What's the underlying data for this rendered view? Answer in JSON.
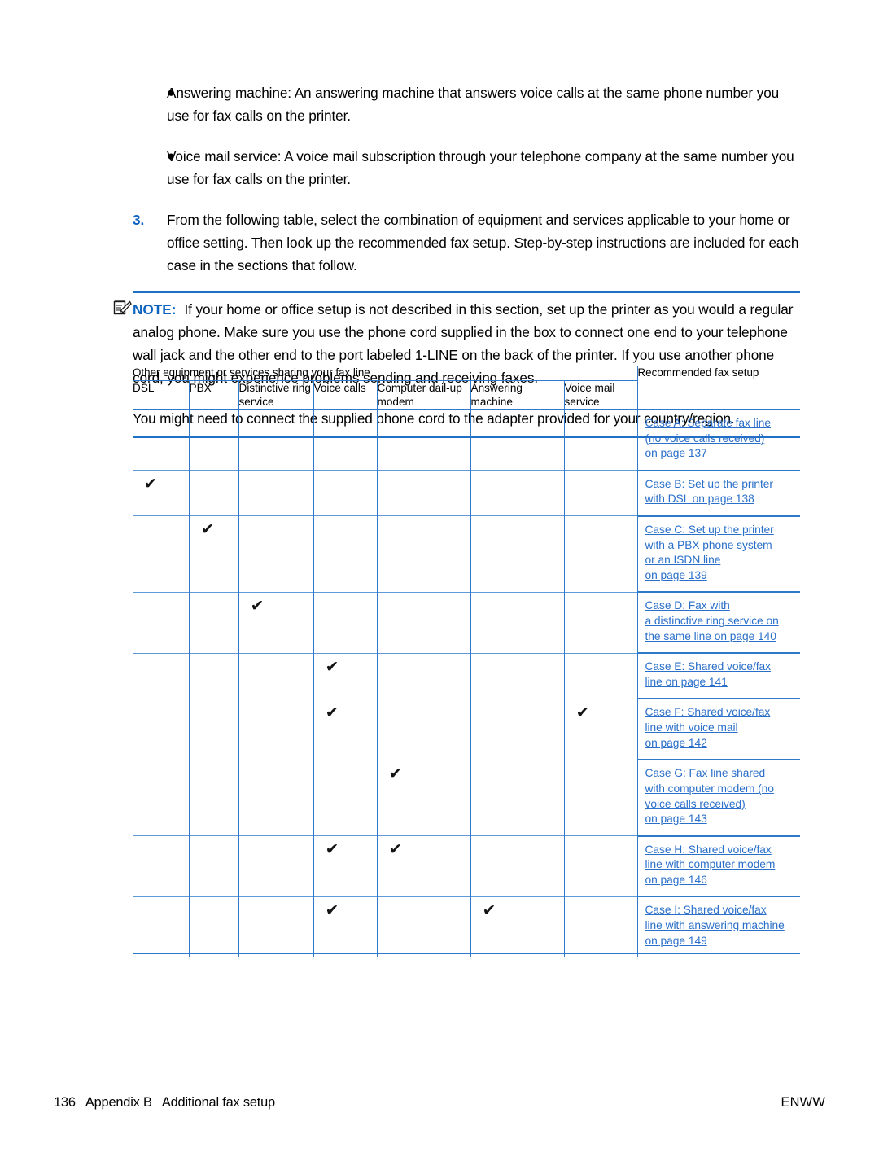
{
  "bullets": [
    {
      "marker": "●",
      "text": "Answering machine: An answering machine that answers voice calls at the same phone number you use for fax calls on the printer."
    },
    {
      "marker": "●",
      "text": "Voice mail service: A voice mail subscription through your telephone company at the same number you use for fax calls on the printer."
    }
  ],
  "step": {
    "number": "3.",
    "text": "From the following table, select the combination of equipment and services applicable to your home or office setting. Then look up the recommended fax setup. Step-by-step instructions are included for each case in the sections that follow."
  },
  "note": {
    "icon": "note-pencil-icon",
    "label": "NOTE:",
    "body": "If your home or office setup is not described in this section, set up the printer as you would a regular analog phone. Make sure you use the phone cord supplied in the box to connect one end to your telephone wall jack and the other end to the port labeled 1-LINE on the back of the printer. If you use another phone cord, you might experience problems sending and receiving faxes.",
    "paragraph2": "You might need to connect the supplied phone cord to the adapter provided for your country/region."
  },
  "table": {
    "group_headers": {
      "left": "Other equipment or services sharing your fax line",
      "right": "Recommended fax setup"
    },
    "columns": [
      "DSL",
      "PBX",
      "Distinctive ring service",
      "Voice calls",
      "Computer dail-up modem",
      "Answering machine",
      "Voice mail service"
    ],
    "check_glyph": "✔",
    "rows": [
      {
        "checks": [
          false,
          false,
          false,
          false,
          false,
          false,
          false
        ],
        "link_lines": [
          "Case A: Separate fax line",
          "(no voice calls received)",
          "on page 137"
        ]
      },
      {
        "checks": [
          true,
          false,
          false,
          false,
          false,
          false,
          false
        ],
        "link_lines": [
          "Case B: Set up the printer",
          "with DSL on page 138"
        ]
      },
      {
        "checks": [
          false,
          true,
          false,
          false,
          false,
          false,
          false
        ],
        "link_lines": [
          "Case C: Set up the printer",
          "with a PBX phone system",
          "or an ISDN line",
          "on page 139"
        ]
      },
      {
        "checks": [
          false,
          false,
          true,
          false,
          false,
          false,
          false
        ],
        "link_lines": [
          "Case D: Fax with",
          "a distinctive ring service on",
          "the same line on page 140"
        ]
      },
      {
        "checks": [
          false,
          false,
          false,
          true,
          false,
          false,
          false
        ],
        "link_lines": [
          "Case E: Shared voice/fax",
          "line on page 141"
        ]
      },
      {
        "checks": [
          false,
          false,
          false,
          true,
          false,
          false,
          true
        ],
        "link_lines": [
          "Case F: Shared voice/fax",
          "line with voice mail",
          "on page 142"
        ]
      },
      {
        "checks": [
          false,
          false,
          false,
          false,
          true,
          false,
          false
        ],
        "link_lines": [
          "Case G: Fax line shared",
          "with computer modem (no",
          "voice calls received)",
          "on page 143"
        ]
      },
      {
        "checks": [
          false,
          false,
          false,
          true,
          true,
          false,
          false
        ],
        "link_lines": [
          "Case H: Shared voice/fax",
          "line with computer modem",
          "on page 146"
        ]
      },
      {
        "checks": [
          false,
          false,
          false,
          true,
          false,
          true,
          false
        ],
        "link_lines": [
          "Case I: Shared voice/fax",
          "line with answering machine",
          "on page 149"
        ]
      }
    ]
  },
  "footer": {
    "left": "136   Appendix B   Additional fax setup",
    "right": "ENWW"
  },
  "colors": {
    "accent_blue": "#0c64c0",
    "rule_blue": "#2f7ac8",
    "light_rule_blue": "#5e9bd6",
    "link_blue": "#2a6fc9"
  }
}
